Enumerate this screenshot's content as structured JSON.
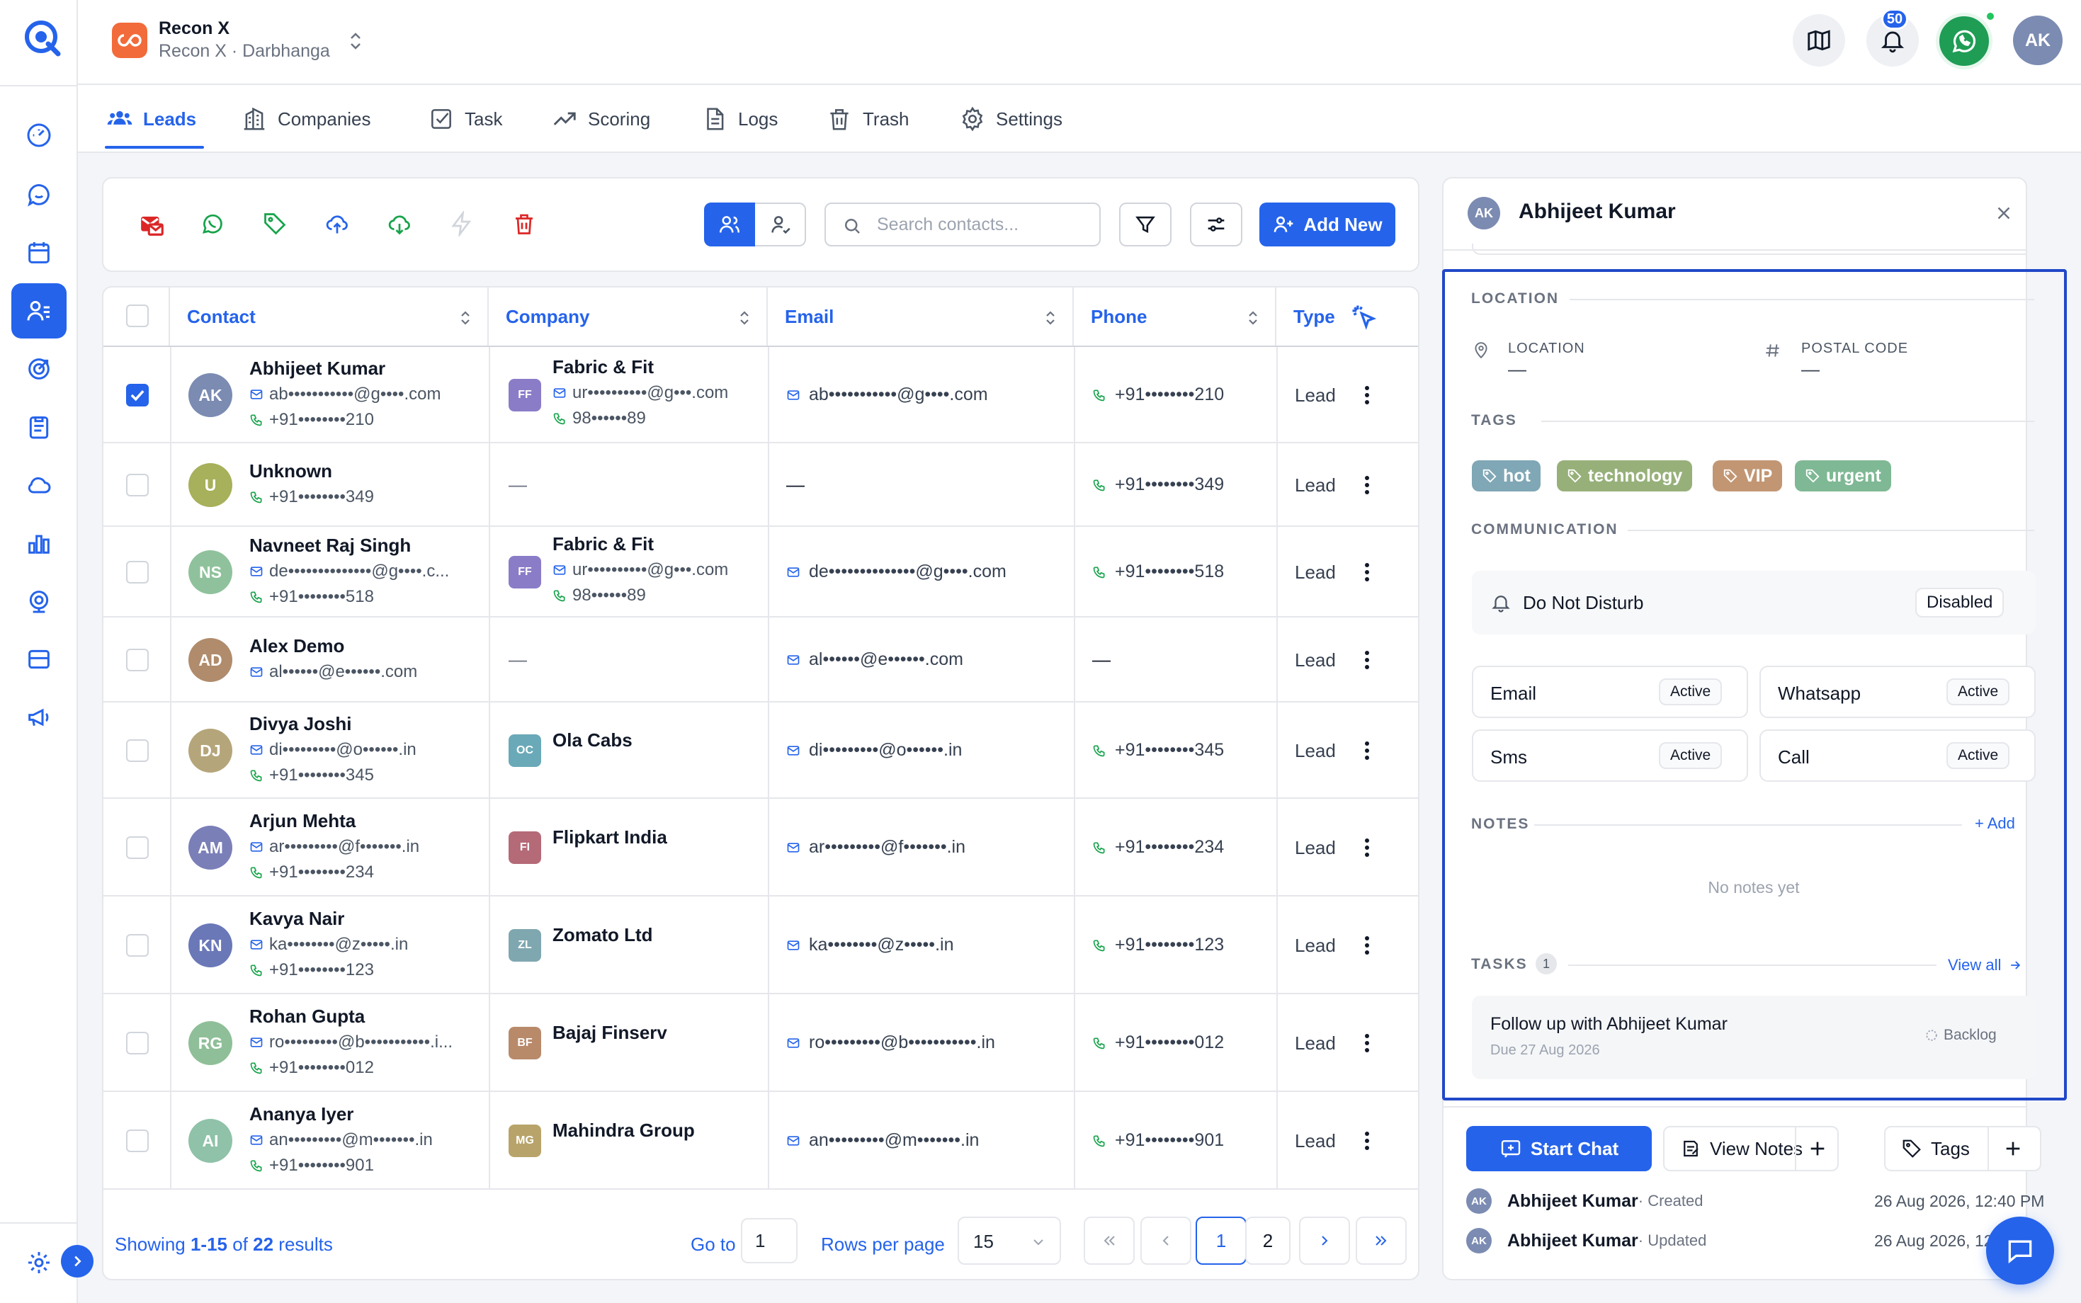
{
  "workspace": {
    "name": "Recon X",
    "subtitle": "Recon X · Darbhanga"
  },
  "header": {
    "notification_count": "50",
    "user_initials": "AK"
  },
  "tabs": [
    {
      "label": "Leads",
      "icon": "users-icon",
      "active": true
    },
    {
      "label": "Companies",
      "icon": "building-icon"
    },
    {
      "label": "Task",
      "icon": "checkbox-icon"
    },
    {
      "label": "Scoring",
      "icon": "trend-icon"
    },
    {
      "label": "Logs",
      "icon": "document-icon"
    },
    {
      "label": "Trash",
      "icon": "trash-icon"
    },
    {
      "label": "Settings",
      "icon": "gear-icon"
    }
  ],
  "toolbar": {
    "search_placeholder": "Search contacts...",
    "add_new_label": "Add New"
  },
  "table": {
    "columns": [
      "Contact",
      "Company",
      "Email",
      "Phone",
      "Type"
    ],
    "rows": [
      {
        "initials": "AK",
        "name": "Abhijeet Kumar",
        "email_sub": "ab•••••••••••@g••••.com",
        "phone_sub": "+91••••••••210",
        "company_initials": "FF",
        "company": "Fabric & Fit",
        "company_email": "ur••••••••••@g•••.com",
        "company_phone": "98••••••89",
        "email": "ab•••••••••••@g••••.com",
        "phone": "+91••••••••210",
        "type": "Lead",
        "checked": true,
        "color": "#7b8bb2",
        "company_color": "#8b7cc8"
      },
      {
        "initials": "U",
        "name": "Unknown",
        "email_sub": "",
        "phone_sub": "+91••••••••349",
        "company_initials": "",
        "company": "",
        "company_email": "",
        "company_phone": "",
        "email": "",
        "phone": "+91••••••••349",
        "type": "Lead",
        "checked": false,
        "color": "#a7b05a",
        "company_color": ""
      },
      {
        "initials": "NS",
        "name": "Navneet Raj Singh",
        "email_sub": "de••••••••••••••@g••••.c...",
        "phone_sub": "+91••••••••518",
        "company_initials": "FF",
        "company": "Fabric & Fit",
        "company_email": "ur••••••••••@g•••.com",
        "company_phone": "98••••••89",
        "email": "de••••••••••••••@g••••.com",
        "phone": "+91••••••••518",
        "type": "Lead",
        "checked": false,
        "color": "#8fc29c",
        "company_color": "#8b7cc8"
      },
      {
        "initials": "AD",
        "name": "Alex Demo",
        "email_sub": "al••••••@e••••••.com",
        "phone_sub": "",
        "company_initials": "",
        "company": "",
        "company_email": "",
        "company_phone": "",
        "email": "al••••••@e••••••.com",
        "phone": "",
        "type": "Lead",
        "checked": false,
        "color": "#b08c6c",
        "company_color": ""
      },
      {
        "initials": "DJ",
        "name": "Divya Joshi",
        "email_sub": "di•••••••••@o••••••.in",
        "phone_sub": "+91••••••••345",
        "company_initials": "OC",
        "company": "Ola Cabs",
        "company_email": "",
        "company_phone": "",
        "email": "di•••••••••@o••••••.in",
        "phone": "+91••••••••345",
        "type": "Lead",
        "checked": false,
        "color": "#b5a57a",
        "company_color": "#6aa9b8"
      },
      {
        "initials": "AM",
        "name": "Arjun Mehta",
        "email_sub": "ar•••••••••@f•••••••.in",
        "phone_sub": "+91••••••••234",
        "company_initials": "FI",
        "company": "Flipkart India",
        "company_email": "",
        "company_phone": "",
        "email": "ar•••••••••@f•••••••.in",
        "phone": "+91••••••••234",
        "type": "Lead",
        "checked": false,
        "color": "#7b7fb8",
        "company_color": "#b56a78"
      },
      {
        "initials": "KN",
        "name": "Kavya Nair",
        "email_sub": "ka••••••••@z•••••.in",
        "phone_sub": "+91••••••••123",
        "company_initials": "ZL",
        "company": "Zomato Ltd",
        "company_email": "",
        "company_phone": "",
        "email": "ka••••••••@z•••••.in",
        "phone": "+91••••••••123",
        "type": "Lead",
        "checked": false,
        "color": "#6a78b8",
        "company_color": "#7fa7b0"
      },
      {
        "initials": "RG",
        "name": "Rohan Gupta",
        "email_sub": "ro•••••••••@b•••••••••••.i...",
        "phone_sub": "+91••••••••012",
        "company_initials": "BF",
        "company": "Bajaj Finserv",
        "company_email": "",
        "company_phone": "",
        "email": "ro•••••••••@b•••••••••••.in",
        "phone": "+91••••••••012",
        "type": "Lead",
        "checked": false,
        "color": "#8fbf98",
        "company_color": "#b88a6a"
      },
      {
        "initials": "AI",
        "name": "Ananya Iyer",
        "email_sub": "an•••••••••@m•••••••.in",
        "phone_sub": "+91••••••••901",
        "company_initials": "MG",
        "company": "Mahindra Group",
        "company_email": "",
        "company_phone": "",
        "email": "an•••••••••@m•••••••.in",
        "phone": "+91••••••••901",
        "type": "Lead",
        "checked": false,
        "color": "#8fc2a8",
        "company_color": "#b8a46a"
      }
    ]
  },
  "footer": {
    "showing_prefix": "Showing ",
    "range": "1-15",
    "of": " of ",
    "total": "22",
    "suffix": " results",
    "goto_label": "Go to",
    "goto_value": "1",
    "rows_label": "Rows per page",
    "rows_value": "15",
    "pages": [
      "1",
      "2"
    ],
    "current_page": "1"
  },
  "panel": {
    "initials": "AK",
    "name": "Abhijeet Kumar",
    "location_section": "LOCATION",
    "location_label": "LOCATION",
    "location_value": "—",
    "postal_label": "POSTAL CODE",
    "postal_value": "—",
    "tags_section": "TAGS",
    "tags": [
      {
        "label": "hot",
        "color": "#7fa7b5"
      },
      {
        "label": "technology",
        "color": "#97b07a"
      },
      {
        "label": "VIP",
        "color": "#c29673"
      },
      {
        "label": "urgent",
        "color": "#7fb894"
      }
    ],
    "communication_section": "COMMUNICATION",
    "dnd_label": "Do Not Disturb",
    "dnd_status": "Disabled",
    "channels": [
      {
        "label": "Email",
        "status": "Active"
      },
      {
        "label": "Whatsapp",
        "status": "Active"
      },
      {
        "label": "Sms",
        "status": "Active"
      },
      {
        "label": "Call",
        "status": "Active"
      }
    ],
    "notes_section": "NOTES",
    "notes_add": "+ Add",
    "notes_empty": "No notes yet",
    "tasks_section": "TASKS",
    "tasks_count": "1",
    "view_all": "View all",
    "task": {
      "title": "Follow up with Abhijeet Kumar",
      "due": "Due 27 Aug 2026",
      "status": "Backlog"
    },
    "start_chat": "Start Chat",
    "view_notes": "View Notes",
    "tags_button": "Tags",
    "activity": [
      {
        "initials": "AK",
        "name": "Abhijeet Kumar",
        "action": " · Created",
        "time": "26 Aug 2026, 12:40 PM"
      },
      {
        "initials": "AK",
        "name": "Abhijeet Kumar",
        "action": " · Updated",
        "time": "26 Aug 2026, 12:40 PM"
      }
    ]
  },
  "colors": {
    "accent": "#2563eb",
    "whatsapp": "#1f9d55",
    "danger": "#dc2626",
    "success": "#16a34a"
  }
}
